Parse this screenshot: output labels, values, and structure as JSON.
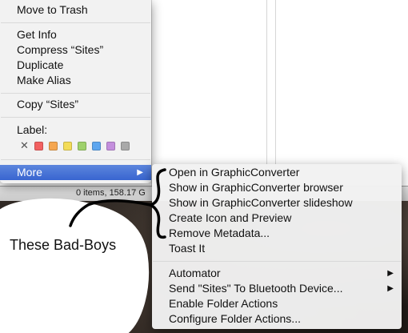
{
  "status_bar": {
    "text": "0 items, 158.17 G"
  },
  "context_menu": {
    "move_to_trash": "Move to Trash",
    "get_info": "Get Info",
    "compress": "Compress “Sites”",
    "duplicate": "Duplicate",
    "make_alias": "Make Alias",
    "copy": "Copy “Sites”",
    "label_title": "Label:",
    "more": "More",
    "label_colors": [
      "#f26161",
      "#f5a650",
      "#f3dc58",
      "#9fd16c",
      "#5ea6ef",
      "#c48fdd",
      "#a9a9a9"
    ]
  },
  "submenu": {
    "open_gc": "Open in GraphicConverter",
    "show_gc_browser": "Show in GraphicConverter browser",
    "show_gc_slideshow": "Show in GraphicConverter slideshow",
    "create_icon": "Create Icon and Preview",
    "remove_metadata": "Remove Metadata...",
    "toast_it": "Toast It",
    "automator": "Automator",
    "send_bluetooth": "Send \"Sites\" To Bluetooth Device...",
    "enable_folder_actions": "Enable Folder Actions",
    "configure_folder_actions": "Configure Folder Actions..."
  },
  "annotation": {
    "text": "These Bad-Boys"
  },
  "colors": {
    "highlight": "#3d6bd3",
    "menu_bg": "#f2f2f2"
  }
}
